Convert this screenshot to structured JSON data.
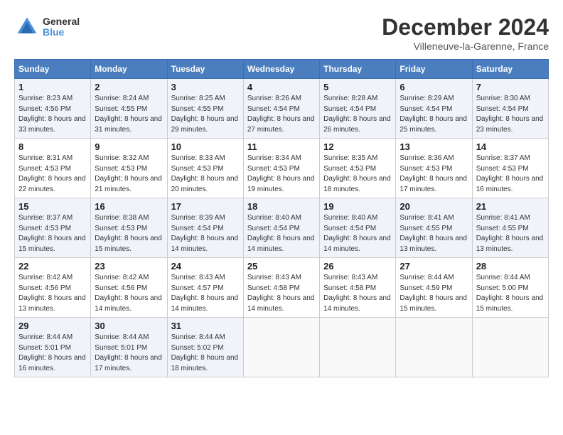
{
  "header": {
    "logo_line1": "General",
    "logo_line2": "Blue",
    "title": "December 2024",
    "subtitle": "Villeneuve-la-Garenne, France"
  },
  "days_of_week": [
    "Sunday",
    "Monday",
    "Tuesday",
    "Wednesday",
    "Thursday",
    "Friday",
    "Saturday"
  ],
  "weeks": [
    [
      {
        "day": "1",
        "sunrise": "8:23 AM",
        "sunset": "4:56 PM",
        "daylight": "8 hours and 33 minutes."
      },
      {
        "day": "2",
        "sunrise": "8:24 AM",
        "sunset": "4:55 PM",
        "daylight": "8 hours and 31 minutes."
      },
      {
        "day": "3",
        "sunrise": "8:25 AM",
        "sunset": "4:55 PM",
        "daylight": "8 hours and 29 minutes."
      },
      {
        "day": "4",
        "sunrise": "8:26 AM",
        "sunset": "4:54 PM",
        "daylight": "8 hours and 27 minutes."
      },
      {
        "day": "5",
        "sunrise": "8:28 AM",
        "sunset": "4:54 PM",
        "daylight": "8 hours and 26 minutes."
      },
      {
        "day": "6",
        "sunrise": "8:29 AM",
        "sunset": "4:54 PM",
        "daylight": "8 hours and 25 minutes."
      },
      {
        "day": "7",
        "sunrise": "8:30 AM",
        "sunset": "4:54 PM",
        "daylight": "8 hours and 23 minutes."
      }
    ],
    [
      {
        "day": "8",
        "sunrise": "8:31 AM",
        "sunset": "4:53 PM",
        "daylight": "8 hours and 22 minutes."
      },
      {
        "day": "9",
        "sunrise": "8:32 AM",
        "sunset": "4:53 PM",
        "daylight": "8 hours and 21 minutes."
      },
      {
        "day": "10",
        "sunrise": "8:33 AM",
        "sunset": "4:53 PM",
        "daylight": "8 hours and 20 minutes."
      },
      {
        "day": "11",
        "sunrise": "8:34 AM",
        "sunset": "4:53 PM",
        "daylight": "8 hours and 19 minutes."
      },
      {
        "day": "12",
        "sunrise": "8:35 AM",
        "sunset": "4:53 PM",
        "daylight": "8 hours and 18 minutes."
      },
      {
        "day": "13",
        "sunrise": "8:36 AM",
        "sunset": "4:53 PM",
        "daylight": "8 hours and 17 minutes."
      },
      {
        "day": "14",
        "sunrise": "8:37 AM",
        "sunset": "4:53 PM",
        "daylight": "8 hours and 16 minutes."
      }
    ],
    [
      {
        "day": "15",
        "sunrise": "8:37 AM",
        "sunset": "4:53 PM",
        "daylight": "8 hours and 15 minutes."
      },
      {
        "day": "16",
        "sunrise": "8:38 AM",
        "sunset": "4:53 PM",
        "daylight": "8 hours and 15 minutes."
      },
      {
        "day": "17",
        "sunrise": "8:39 AM",
        "sunset": "4:54 PM",
        "daylight": "8 hours and 14 minutes."
      },
      {
        "day": "18",
        "sunrise": "8:40 AM",
        "sunset": "4:54 PM",
        "daylight": "8 hours and 14 minutes."
      },
      {
        "day": "19",
        "sunrise": "8:40 AM",
        "sunset": "4:54 PM",
        "daylight": "8 hours and 14 minutes."
      },
      {
        "day": "20",
        "sunrise": "8:41 AM",
        "sunset": "4:55 PM",
        "daylight": "8 hours and 13 minutes."
      },
      {
        "day": "21",
        "sunrise": "8:41 AM",
        "sunset": "4:55 PM",
        "daylight": "8 hours and 13 minutes."
      }
    ],
    [
      {
        "day": "22",
        "sunrise": "8:42 AM",
        "sunset": "4:56 PM",
        "daylight": "8 hours and 13 minutes."
      },
      {
        "day": "23",
        "sunrise": "8:42 AM",
        "sunset": "4:56 PM",
        "daylight": "8 hours and 14 minutes."
      },
      {
        "day": "24",
        "sunrise": "8:43 AM",
        "sunset": "4:57 PM",
        "daylight": "8 hours and 14 minutes."
      },
      {
        "day": "25",
        "sunrise": "8:43 AM",
        "sunset": "4:58 PM",
        "daylight": "8 hours and 14 minutes."
      },
      {
        "day": "26",
        "sunrise": "8:43 AM",
        "sunset": "4:58 PM",
        "daylight": "8 hours and 14 minutes."
      },
      {
        "day": "27",
        "sunrise": "8:44 AM",
        "sunset": "4:59 PM",
        "daylight": "8 hours and 15 minutes."
      },
      {
        "day": "28",
        "sunrise": "8:44 AM",
        "sunset": "5:00 PM",
        "daylight": "8 hours and 15 minutes."
      }
    ],
    [
      {
        "day": "29",
        "sunrise": "8:44 AM",
        "sunset": "5:01 PM",
        "daylight": "8 hours and 16 minutes."
      },
      {
        "day": "30",
        "sunrise": "8:44 AM",
        "sunset": "5:01 PM",
        "daylight": "8 hours and 17 minutes."
      },
      {
        "day": "31",
        "sunrise": "8:44 AM",
        "sunset": "5:02 PM",
        "daylight": "8 hours and 18 minutes."
      },
      null,
      null,
      null,
      null
    ]
  ]
}
